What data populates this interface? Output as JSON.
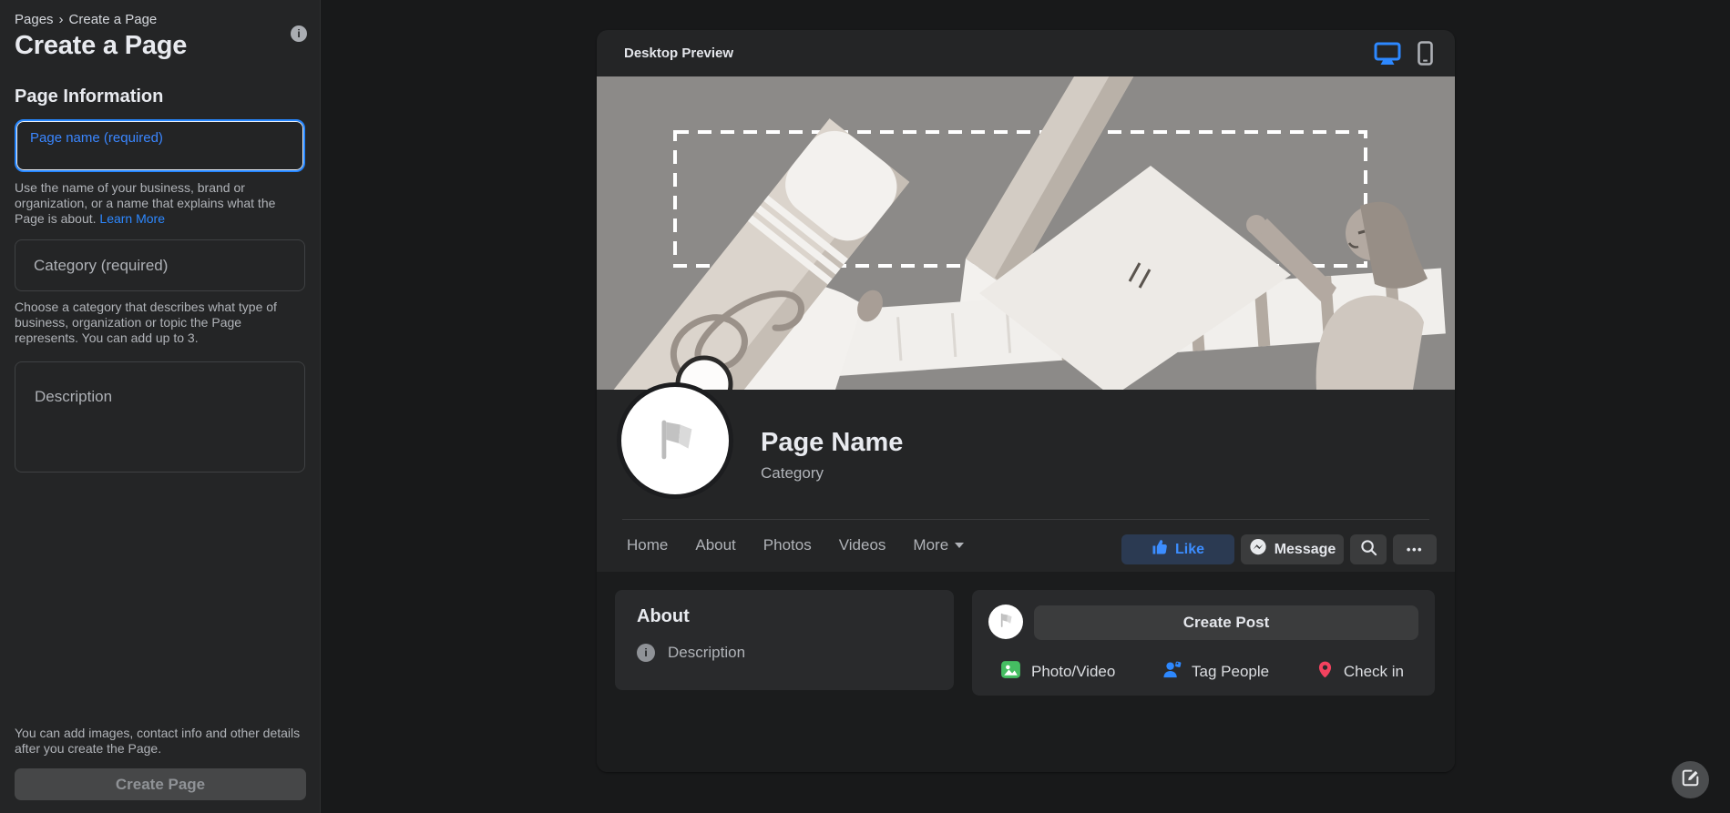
{
  "colors": {
    "accent_blue": "#2d88ff",
    "focused_input_border": "#2586ff",
    "like_button_bg": "#2b3a52",
    "photo_green": "#45bd62",
    "tag_blue": "#2d88ff",
    "checkin_red": "#f3425f",
    "sidebar_bg": "#242526",
    "main_bg": "#18191a"
  },
  "sidebar": {
    "breadcrumb": {
      "root": "Pages",
      "separator": "›",
      "current": "Create a Page"
    },
    "title": "Create a Page",
    "info_icon": "i",
    "section_heading": "Page Information",
    "page_name": {
      "placeholder": "Page name (required)"
    },
    "page_name_helper": {
      "text": "Use the name of your business, brand or organization, or a name that explains what the Page is about. ",
      "link": "Learn More"
    },
    "category": {
      "placeholder": "Category (required)"
    },
    "category_helper": "Choose a category that describes what type of business, organization or topic the Page represents. You can add up to 3.",
    "description": {
      "placeholder": "Description"
    },
    "footer_note": "You can add images, contact info and other details after you create the Page.",
    "create_button_label": "Create Page"
  },
  "preview": {
    "header": {
      "title": "Desktop Preview"
    },
    "page": {
      "name": "Page Name",
      "category": "Category",
      "tabs": [
        "Home",
        "About",
        "Photos",
        "Videos"
      ],
      "more_tab": "More",
      "like_label": "Like",
      "message_label": "Message",
      "more_menu_label": "•••",
      "about": {
        "title": "About",
        "description_label": "Description",
        "info_icon": "i"
      },
      "composer": {
        "placeholder": "Create Post",
        "photo_video_label": "Photo/Video",
        "tag_people_label": "Tag People",
        "check_in_label": "Check in"
      }
    }
  }
}
